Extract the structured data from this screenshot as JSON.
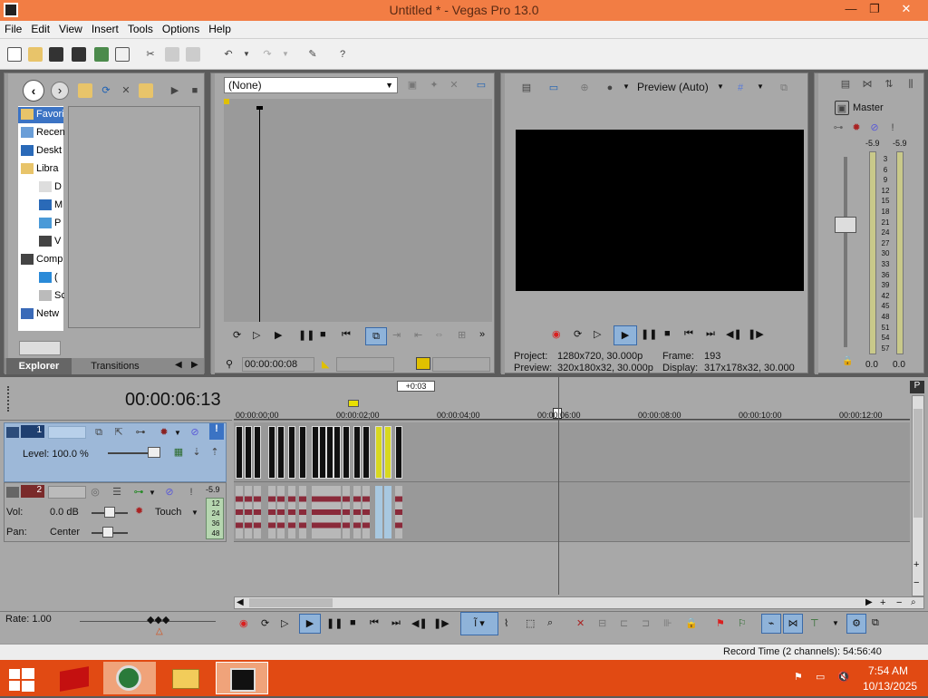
{
  "window": {
    "title": "Untitled * - Vegas Pro 13.0",
    "min": "—",
    "restore": "❐",
    "close": "✕"
  },
  "menu": [
    "File",
    "Edit",
    "View",
    "Insert",
    "Tools",
    "Options",
    "Help"
  ],
  "explorer": {
    "tree": [
      {
        "label": "Favori",
        "icon": "star-folder-icon",
        "indent": 0
      },
      {
        "label": "Recen",
        "icon": "recent-icon",
        "indent": 0
      },
      {
        "label": "Deskt",
        "icon": "desktop-icon",
        "indent": 0
      },
      {
        "label": "Libra",
        "icon": "library-icon",
        "indent": 0
      },
      {
        "label": "D",
        "icon": "documents-icon",
        "indent": 1
      },
      {
        "label": "M",
        "icon": "music-icon",
        "indent": 1
      },
      {
        "label": "P",
        "icon": "pictures-icon",
        "indent": 1
      },
      {
        "label": "V",
        "icon": "videos-icon",
        "indent": 1
      },
      {
        "label": "Comp",
        "icon": "computer-icon",
        "indent": 0
      },
      {
        "label": "(",
        "icon": "drive-icon",
        "indent": 1
      },
      {
        "label": "Sc",
        "icon": "cd-icon",
        "indent": 1
      },
      {
        "label": "Netw",
        "icon": "network-icon",
        "indent": 0
      }
    ],
    "tabs": [
      "Explorer",
      "Transitions"
    ]
  },
  "trimmer": {
    "dropdown": "(None)",
    "timecode": "00:00:00:08"
  },
  "preview": {
    "quality": "Preview (Auto)",
    "project_label": "Project:",
    "project_value": "1280x720, 30.000p",
    "frame_label": "Frame:",
    "frame_value": "193",
    "preview_label": "Preview:",
    "preview_value": "320x180x32, 30.000p",
    "display_label": "Display:",
    "display_value": "317x178x32, 30.000"
  },
  "master": {
    "label": "Master",
    "left_peak": "-5.9",
    "right_peak": "-5.9",
    "scale": [
      "3",
      "6",
      "9",
      "12",
      "15",
      "18",
      "21",
      "24",
      "27",
      "30",
      "33",
      "36",
      "39",
      "42",
      "45",
      "48",
      "51",
      "54",
      "57"
    ],
    "left_val": "0.0",
    "right_val": "0.0"
  },
  "timeline": {
    "timecode": "00:00:06:13",
    "marker_label": "+0:03",
    "ruler": [
      "00:00:00;00",
      "00:00:02;00",
      "00:00:04;00",
      "00:00;06:00",
      "00:00:08:00",
      "00:00:10:00",
      "00:00:12:00"
    ],
    "ruler_overlay": "6:00"
  },
  "tracks": {
    "video": {
      "number": "1",
      "level_label": "Level: 100.0 %"
    },
    "audio": {
      "number": "2",
      "vol_label": "Vol:",
      "vol_value": "0.0 dB",
      "pan_label": "Pan:",
      "pan_value": "Center",
      "mode": "Touch",
      "peak": "-5.9",
      "meter_scale": [
        "12",
        "24",
        "36",
        "48"
      ]
    }
  },
  "rate": "Rate: 1.00",
  "record_time": "Record Time (2 channels): 54:56:40",
  "clock": {
    "time": "7:54 AM",
    "date": "10/13/2025"
  },
  "colors": {
    "titlebar": "#f27d44",
    "taskbar": "#e14a13",
    "panel": "#a8a8a8",
    "selected_track": "#9db8d8"
  }
}
